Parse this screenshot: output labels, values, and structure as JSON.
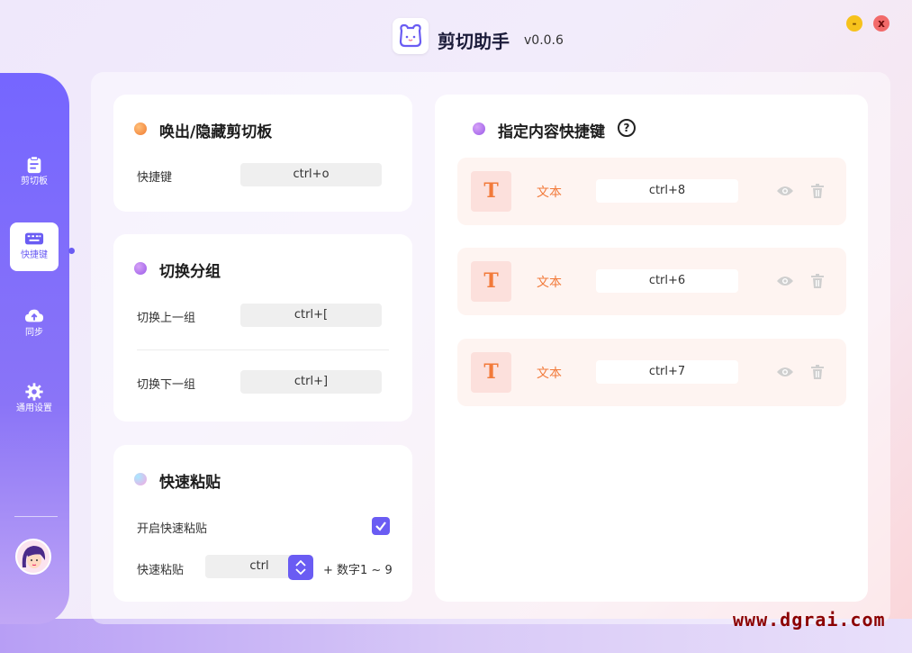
{
  "app": {
    "title": "剪切助手",
    "version": "v0.0.6",
    "min_label": "-",
    "close_label": "x"
  },
  "sidebar": {
    "items": [
      {
        "label": "剪切板",
        "icon": "clipboard-icon"
      },
      {
        "label": "快捷键",
        "icon": "keyboard-icon",
        "active": true
      },
      {
        "label": "同步",
        "icon": "cloud-upload-icon"
      },
      {
        "label": "通用设置",
        "icon": "gear-icon"
      }
    ]
  },
  "toggle_card": {
    "title": "唤出/隐藏剪切板",
    "rows": [
      {
        "label": "快捷键",
        "key": "ctrl+o"
      }
    ]
  },
  "group_card": {
    "title": "切换分组",
    "rows": [
      {
        "label": "切换上一组",
        "key": "ctrl+["
      },
      {
        "label": "切换下一组",
        "key": "ctrl+]"
      }
    ]
  },
  "paste_card": {
    "title": "快速粘贴",
    "enable_label": "开启快速粘贴",
    "enabled": true,
    "paste_label": "快速粘贴",
    "modifier": "ctrl",
    "suffix": "+ 数字1 ~ 9"
  },
  "content_card": {
    "title": "指定内容快捷键",
    "help": "?",
    "items": [
      {
        "type_icon": "T",
        "type": "文本",
        "key": "ctrl+8"
      },
      {
        "type_icon": "T",
        "type": "文本",
        "key": "ctrl+6"
      },
      {
        "type_icon": "T",
        "type": "文本",
        "key": "ctrl+7"
      }
    ]
  },
  "watermark": "www.dgrai.com",
  "colors": {
    "accent": "#6a5cf3",
    "orange": "#f27a3a",
    "row_bg": "#fef4f1"
  }
}
